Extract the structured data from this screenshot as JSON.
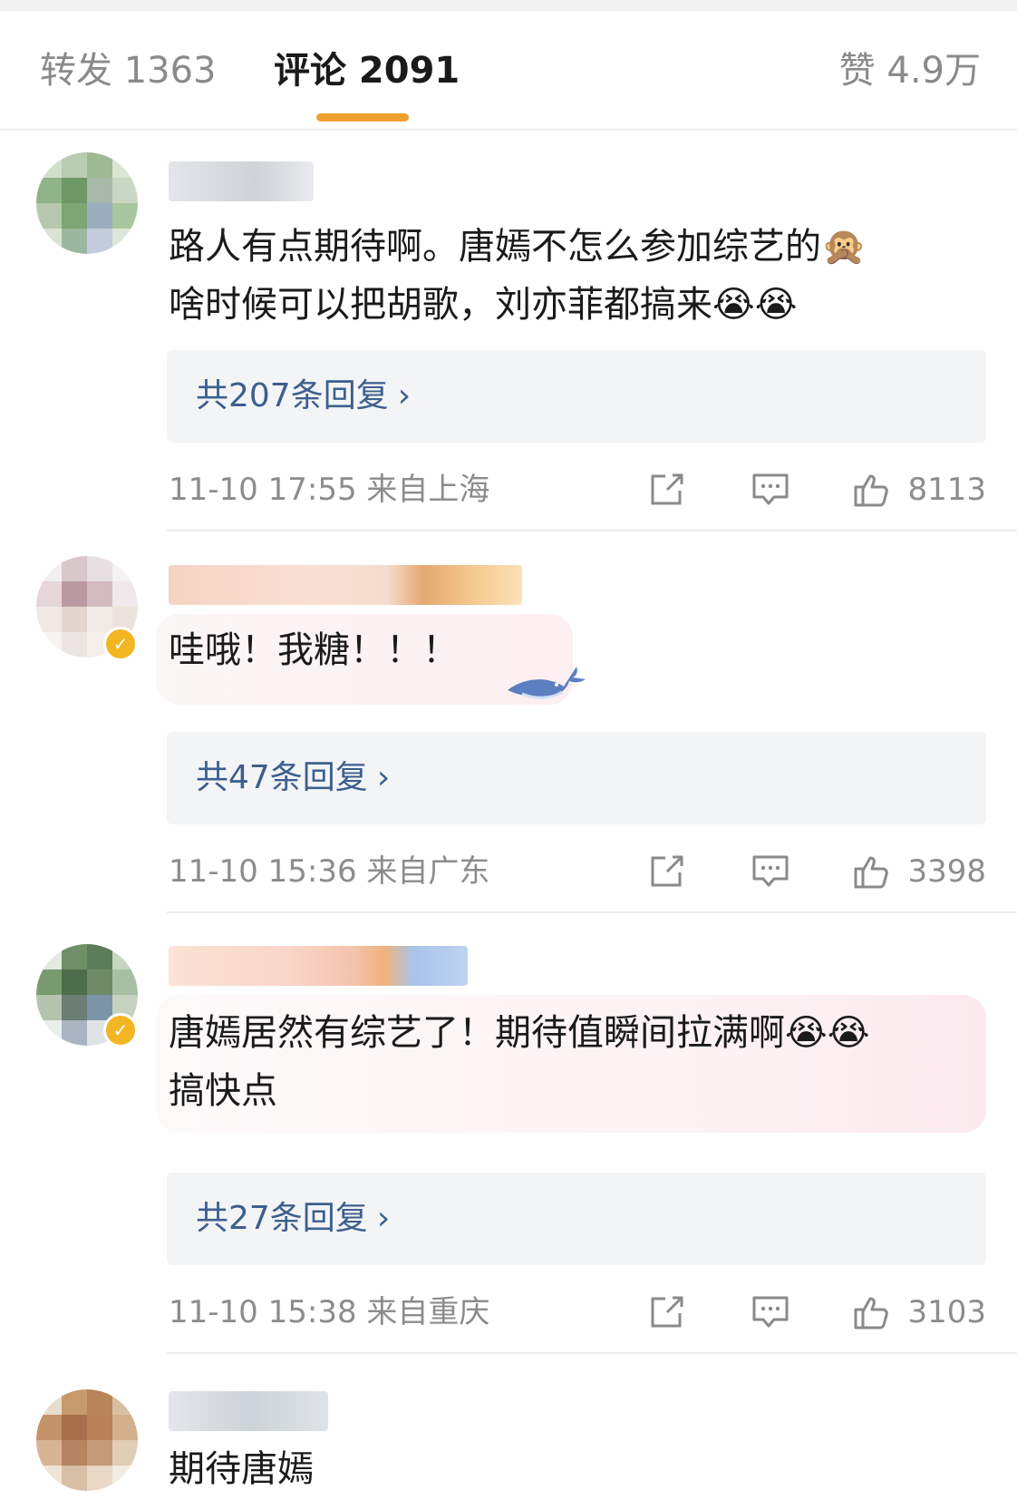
{
  "tabs": {
    "repost_label": "转发 1363",
    "comments_label": "评论 2091",
    "likes_label": "赞 4.9万",
    "active_color": "#f0a030"
  },
  "comments": [
    {
      "text_line1": "路人有点期待啊。唐嫣不怎么参加综艺的🙊",
      "text_line2": "啥时候可以把胡歌，刘亦菲都搞来😭😭",
      "replies_label": "共207条回复",
      "time": "11-10 17:55",
      "location": "来自上海",
      "likes": "8113"
    },
    {
      "text_line1": "哇哦！我糖！！！",
      "text_line2": "",
      "replies_label": "共47条回复",
      "time": "11-10 15:36",
      "location": "来自广东",
      "likes": "3398",
      "verified": true
    },
    {
      "text_line1": "唐嫣居然有综艺了！期待值瞬间拉满啊😭😭",
      "text_line2": "搞快点",
      "replies_label": "共27条回复",
      "time": "11-10 15:38",
      "location": "来自重庆",
      "likes": "3103",
      "verified": true
    },
    {
      "text_line1": "期待唐嫣"
    }
  ],
  "icons": {
    "share": "share-icon",
    "reply": "comment-icon",
    "like": "thumbs-up-icon",
    "chevron": "chevron-right-icon"
  },
  "chevron_glyph": "›"
}
